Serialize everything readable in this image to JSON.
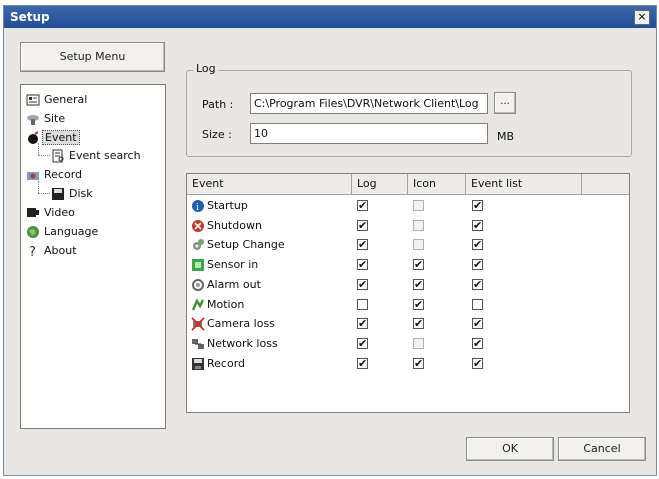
{
  "window": {
    "title": "Setup",
    "close_glyph": "×"
  },
  "setup_menu_label": "Setup Menu",
  "tree": [
    {
      "label": "General",
      "icon": "general-icon",
      "level": 0
    },
    {
      "label": "Site",
      "icon": "site-icon",
      "level": 0
    },
    {
      "label": "Event",
      "icon": "event-icon",
      "level": 0,
      "selected": true
    },
    {
      "label": "Event search",
      "icon": "event-search-icon",
      "level": 1
    },
    {
      "label": "Record",
      "icon": "record-icon",
      "level": 0
    },
    {
      "label": "Disk",
      "icon": "disk-icon",
      "level": 1
    },
    {
      "label": "Video",
      "icon": "video-icon",
      "level": 0
    },
    {
      "label": "Language",
      "icon": "language-icon",
      "level": 0
    },
    {
      "label": "About",
      "icon": "about-icon",
      "level": 0
    }
  ],
  "log": {
    "title": "Log",
    "path_label": "Path :",
    "path_value": "C:\\Program Files\\DVR\\Network Client\\Log",
    "browse_label": "...",
    "size_label": "Size :",
    "size_value": "10",
    "size_unit": "MB"
  },
  "columns": [
    "Event",
    "Log",
    "Icon",
    "Event list"
  ],
  "events": [
    {
      "name": "Startup",
      "icon": "info-icon",
      "log": true,
      "icon_enabled": false,
      "icon_checked": false,
      "list": true
    },
    {
      "name": "Shutdown",
      "icon": "shutdown-icon",
      "log": true,
      "icon_enabled": false,
      "icon_checked": false,
      "list": true
    },
    {
      "name": "Setup Change",
      "icon": "setup-change-icon",
      "log": true,
      "icon_enabled": false,
      "icon_checked": false,
      "list": true
    },
    {
      "name": "Sensor in",
      "icon": "sensor-icon",
      "log": true,
      "icon_enabled": true,
      "icon_checked": true,
      "list": true
    },
    {
      "name": "Alarm out",
      "icon": "alarm-icon",
      "log": true,
      "icon_enabled": true,
      "icon_checked": true,
      "list": true
    },
    {
      "name": "Motion",
      "icon": "motion-icon",
      "log": false,
      "icon_enabled": true,
      "icon_checked": true,
      "list": false
    },
    {
      "name": "Camera loss",
      "icon": "camera-loss-icon",
      "log": true,
      "icon_enabled": true,
      "icon_checked": true,
      "list": true
    },
    {
      "name": "Network loss",
      "icon": "network-loss-icon",
      "log": true,
      "icon_enabled": false,
      "icon_checked": false,
      "list": true
    },
    {
      "name": "Record",
      "icon": "record-disk-icon",
      "log": true,
      "icon_enabled": true,
      "icon_checked": true,
      "list": true
    }
  ],
  "check_glyph": "✔",
  "ok_label": "OK",
  "cancel_label": "Cancel"
}
